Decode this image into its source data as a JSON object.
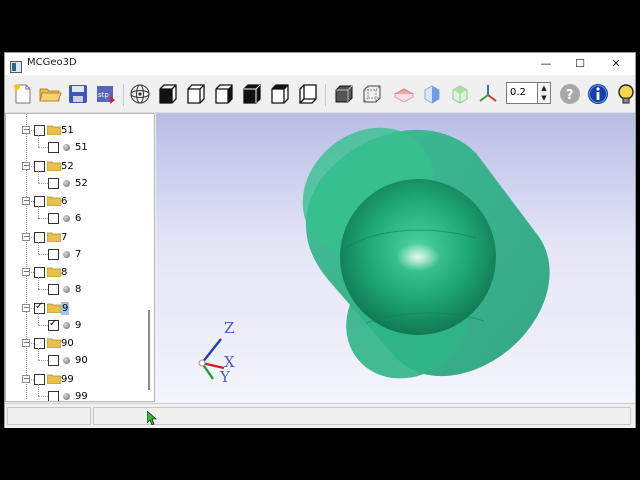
{
  "window": {
    "title": "MCGeo3D",
    "controls": {
      "minimize": "—",
      "maximize": "☐",
      "close": "✕"
    }
  },
  "toolbar": {
    "buttons": [
      {
        "name": "new-file"
      },
      {
        "name": "open-folder"
      },
      {
        "name": "save"
      },
      {
        "name": "export-stp",
        "label": "stp"
      },
      {
        "name": "view-orbit"
      },
      {
        "name": "view-front"
      },
      {
        "name": "view-back"
      },
      {
        "name": "view-left"
      },
      {
        "name": "view-right"
      },
      {
        "name": "view-top"
      },
      {
        "name": "view-bottom"
      },
      {
        "name": "shaded-mode"
      },
      {
        "name": "wireframe-mode"
      },
      {
        "name": "section-xy"
      },
      {
        "name": "section-yz"
      },
      {
        "name": "section-zx"
      },
      {
        "name": "axes"
      }
    ],
    "zoom_value": "0.2",
    "colors": {
      "accent": "#1565c0",
      "help_gray": "#a0a0a0",
      "info_blue": "#1240a8",
      "bulb_yellow": "#f6d64a"
    }
  },
  "tree": {
    "items": [
      {
        "folder": "51",
        "child": "51",
        "checked": false
      },
      {
        "folder": "52",
        "child": "52",
        "checked": false
      },
      {
        "folder": "6",
        "child": "6",
        "checked": false
      },
      {
        "folder": "7",
        "child": "7",
        "checked": false
      },
      {
        "folder": "8",
        "child": "8",
        "checked": false
      },
      {
        "folder": "9",
        "child": "9",
        "checked": true,
        "selected": true
      },
      {
        "folder": "90",
        "child": "90",
        "checked": false
      },
      {
        "folder": "99",
        "child": "99",
        "checked": false
      }
    ]
  },
  "viewport": {
    "axis_labels": {
      "z": "Z",
      "x": "X",
      "y": "Y"
    },
    "colors": {
      "cylinder": "#2bb080",
      "sphere": "#1fa372",
      "background_top": "#b9bde6",
      "background_bottom": "#f4f4fb"
    }
  },
  "status": {
    "pane1": "",
    "pane2": ""
  }
}
